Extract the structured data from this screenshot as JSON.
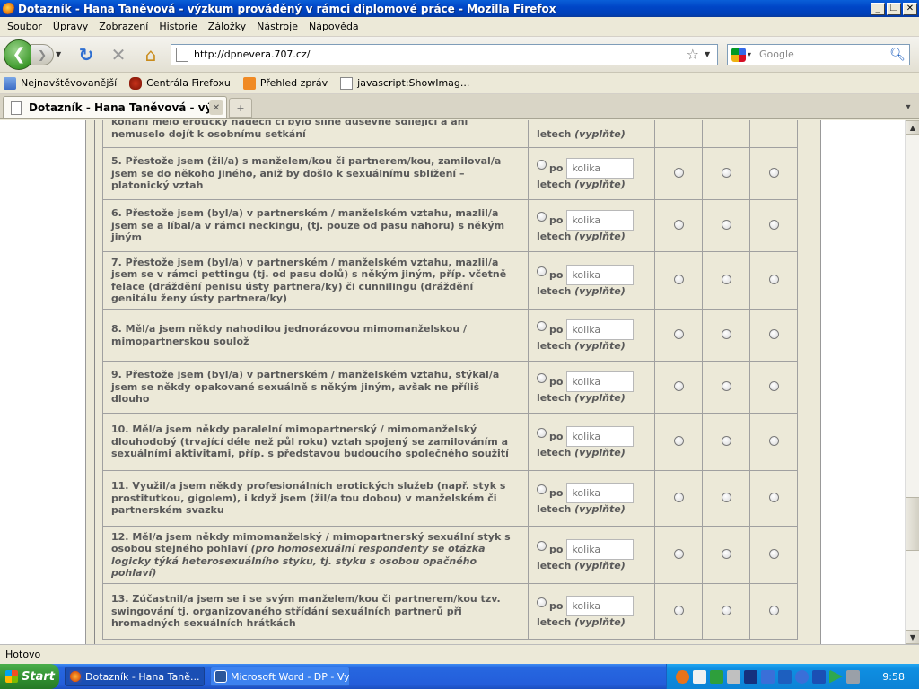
{
  "window": {
    "title": "Dotazník - Hana Taněvová - výzkum prováděný v rámci diplomové práce - Mozilla Firefox",
    "minimize": "_",
    "restore": "❐",
    "close": "✕"
  },
  "menu": [
    "Soubor",
    "Úpravy",
    "Zobrazení",
    "Historie",
    "Záložky",
    "Nástroje",
    "Nápověda"
  ],
  "nav": {
    "url": "http://dpnevera.707.cz/",
    "search_placeholder": "Google"
  },
  "bookmarks": [
    "Nejnavštěvovanější",
    "Centrála Firefoxu",
    "Přehled zpráv",
    "javascript:ShowImag..."
  ],
  "tab": {
    "title": "Dotazník - Hana Taněvová - výzkum...",
    "new_tab": "+"
  },
  "questionnaire": {
    "freq_po": "po",
    "freq_placeholder": "kolika",
    "freq_letech": "letech",
    "freq_hint": "(vyplňte)",
    "rows": [
      {
        "text": "konání mělo erotický nádech či bylo silně duševně sdílející a ani nemuselo dojít k osobnímu setkání",
        "note": "",
        "partial": true
      },
      {
        "text": "5. Přestože jsem (žil/a) s manželem/kou či partnerem/kou, zamiloval/a jsem se do někoho jiného, aniž by došlo k sexuálnímu sblížení – platonický vztah",
        "note": ""
      },
      {
        "text": "6. Přestože jsem (byl/a) v partnerském / manželském vztahu, mazlil/a jsem se a líbal/a v rámci neckingu, (tj. pouze od pasu nahoru) s někým jiným",
        "note": ""
      },
      {
        "text": "7. Přestože jsem (byl/a) v partnerském / manželském vztahu, mazlil/a jsem se v rámci pettingu (tj. od pasu dolů) s někým jiným, příp. včetně felace (dráždění penisu ústy partnera/ky) či cunnilingu (dráždění genitálu ženy ústy partnera/ky)",
        "note": ""
      },
      {
        "text": "8. Měl/a jsem někdy nahodilou jednorázovou mimomanželskou / mimopartnerskou soulož",
        "note": ""
      },
      {
        "text": "9. Přestože jsem (byl/a) v partnerském / manželském vztahu, stýkal/a jsem se někdy opakované sexuálně s někým jiným, avšak ne příliš dlouho",
        "note": ""
      },
      {
        "text": "10. Měl/a jsem někdy paralelní mimopartnerský / mimomanželský dlouhodobý (trvající déle než půl roku) vztah spojený se zamilováním a sexuálními aktivitami, příp. s představou budoucího společného soužití",
        "note": ""
      },
      {
        "text": "11. Využil/a jsem někdy profesionálních erotických služeb (např. styk s prostitutkou, gigolem), i když jsem (žil/a tou dobou) v manželském či partnerském svazku",
        "note": ""
      },
      {
        "text": "12. Měl/a jsem někdy mimomanželský / mimopartnerský sexuální styk s osobou stejného pohlaví ",
        "note": "(pro homosexuální respondenty se otázka logicky týká heterosexuálního styku, tj. styku s osobou opačného pohlaví)"
      },
      {
        "text": "13. Zúčastnil/a jsem se i se svým manželem/kou či partnerem/kou tzv. swingování tj. organizovaného střídání sexuálních partnerů při hromadných sexuálních hrátkách",
        "note": ""
      }
    ]
  },
  "status": "Hotovo",
  "taskbar": {
    "start": "Start",
    "tasks": [
      "Dotazník - Hana Taně...",
      "Microsoft Word - DP - Vyf..."
    ],
    "clock": "9:58"
  },
  "colors": {
    "titlebar": "#0046c7",
    "page_bg": "#ece9d8",
    "question_text": "#595959",
    "taskbar": "#245edb"
  }
}
